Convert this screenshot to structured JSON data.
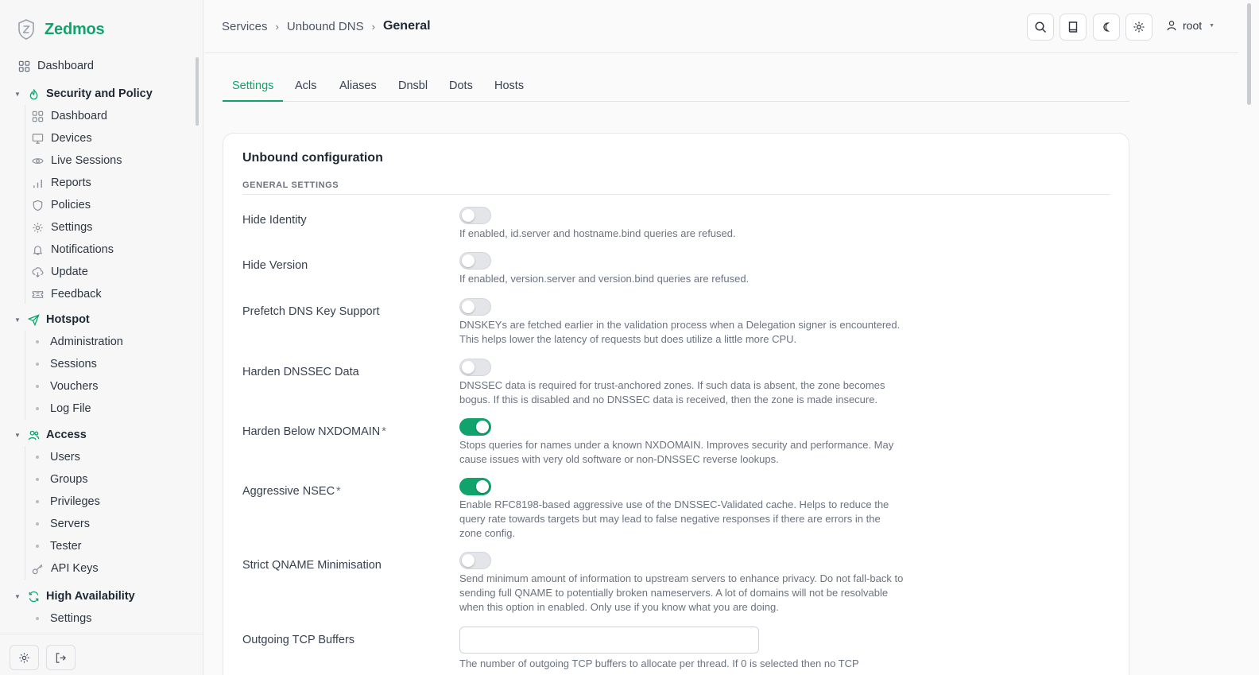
{
  "brand": {
    "name": "Zedmos",
    "accent": "#10a36b"
  },
  "sidebar": {
    "top_item": {
      "label": "Dashboard",
      "icon": "dashboard-icon"
    },
    "groups": [
      {
        "label": "Security and Policy",
        "icon": "flame-icon",
        "items": [
          {
            "label": "Dashboard",
            "icon": "dashboard-icon"
          },
          {
            "label": "Devices",
            "icon": "monitor-icon"
          },
          {
            "label": "Live Sessions",
            "icon": "eye-icon"
          },
          {
            "label": "Reports",
            "icon": "bar-chart-icon"
          },
          {
            "label": "Policies",
            "icon": "shield-icon"
          },
          {
            "label": "Settings",
            "icon": "gear-icon"
          },
          {
            "label": "Notifications",
            "icon": "bell-icon"
          },
          {
            "label": "Update",
            "icon": "cloud-download-icon"
          },
          {
            "label": "Feedback",
            "icon": "ticket-icon"
          }
        ]
      },
      {
        "label": "Hotspot",
        "icon": "send-icon",
        "items": [
          {
            "label": "Administration"
          },
          {
            "label": "Sessions"
          },
          {
            "label": "Vouchers"
          },
          {
            "label": "Log File"
          }
        ]
      },
      {
        "label": "Access",
        "icon": "users-icon",
        "items": [
          {
            "label": "Users"
          },
          {
            "label": "Groups"
          },
          {
            "label": "Privileges"
          },
          {
            "label": "Servers"
          },
          {
            "label": "Tester"
          },
          {
            "label": "API Keys",
            "icon": "key-icon"
          }
        ]
      },
      {
        "label": "High Availability",
        "icon": "refresh-icon",
        "items": [
          {
            "label": "Settings"
          }
        ]
      }
    ]
  },
  "breadcrumb": {
    "items": [
      "Services",
      "Unbound DNS"
    ],
    "current": "General"
  },
  "user": {
    "name": "root"
  },
  "tabs": [
    "Settings",
    "Acls",
    "Aliases",
    "Dnsbl",
    "Dots",
    "Hosts"
  ],
  "active_tab": "Settings",
  "card": {
    "title": "Unbound configuration",
    "section": "GENERAL SETTINGS",
    "settings": [
      {
        "label": "Hide Identity",
        "required": false,
        "enabled": false,
        "help": "If enabled, id.server and hostname.bind queries are refused."
      },
      {
        "label": "Hide Version",
        "required": false,
        "enabled": false,
        "help": "If enabled, version.server and version.bind queries are refused."
      },
      {
        "label": "Prefetch DNS Key Support",
        "required": false,
        "enabled": false,
        "help": "DNSKEYs are fetched earlier in the validation process when a Delegation signer is encountered. This helps lower the latency of requests but does utilize a little more CPU."
      },
      {
        "label": "Harden DNSSEC Data",
        "required": false,
        "enabled": false,
        "help": "DNSSEC data is required for trust-anchored zones. If such data is absent, the zone becomes bogus. If this is disabled and no DNSSEC data is received, then the zone is made insecure."
      },
      {
        "label": "Harden Below NXDOMAIN",
        "required": true,
        "enabled": true,
        "help": "Stops queries for names under a known NXDOMAIN. Improves security and performance. May cause issues with very old software or non-DNSSEC reverse lookups."
      },
      {
        "label": "Aggressive NSEC",
        "required": true,
        "enabled": true,
        "help": "Enable RFC8198-based aggressive use of the DNSSEC-Validated cache. Helps to reduce the query rate towards targets but may lead to false negative responses if there are errors in the zone config."
      },
      {
        "label": "Strict QNAME Minimisation",
        "required": false,
        "enabled": false,
        "help": "Send minimum amount of information to upstream servers to enhance privacy. Do not fall-back to sending full QNAME to potentially broken nameservers. A lot of domains will not be resolvable when this option in enabled. Only use if you know what you are doing."
      }
    ],
    "tcp_buffers": {
      "label": "Outgoing TCP Buffers",
      "value": "",
      "help": "The number of outgoing TCP buffers to allocate per thread. If 0 is selected then no TCP"
    }
  },
  "required_marker": "*"
}
